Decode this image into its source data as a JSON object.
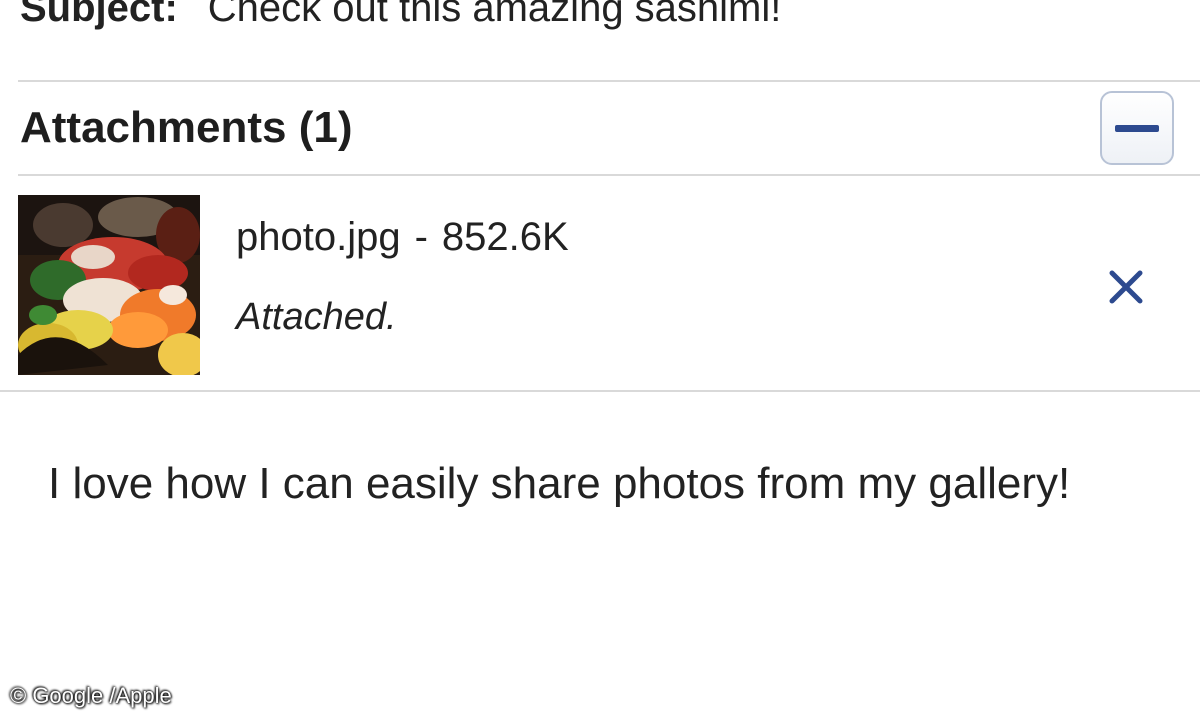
{
  "subject": {
    "label": "Subject:",
    "value": "Check out this amazing sashimi!"
  },
  "attachments": {
    "title": "Attachments (1)",
    "collapse_icon": "minus-icon",
    "items": [
      {
        "filename": "photo.jpg",
        "separator": "-",
        "size": "852.6K",
        "status": "Attached.",
        "remove_icon": "close-icon"
      }
    ]
  },
  "message": {
    "body": "I love how I can easily share photos from my gallery!"
  },
  "watermark": "© Google /Apple",
  "colors": {
    "accent": "#2d4a8f",
    "divider": "#d9d9d9"
  }
}
